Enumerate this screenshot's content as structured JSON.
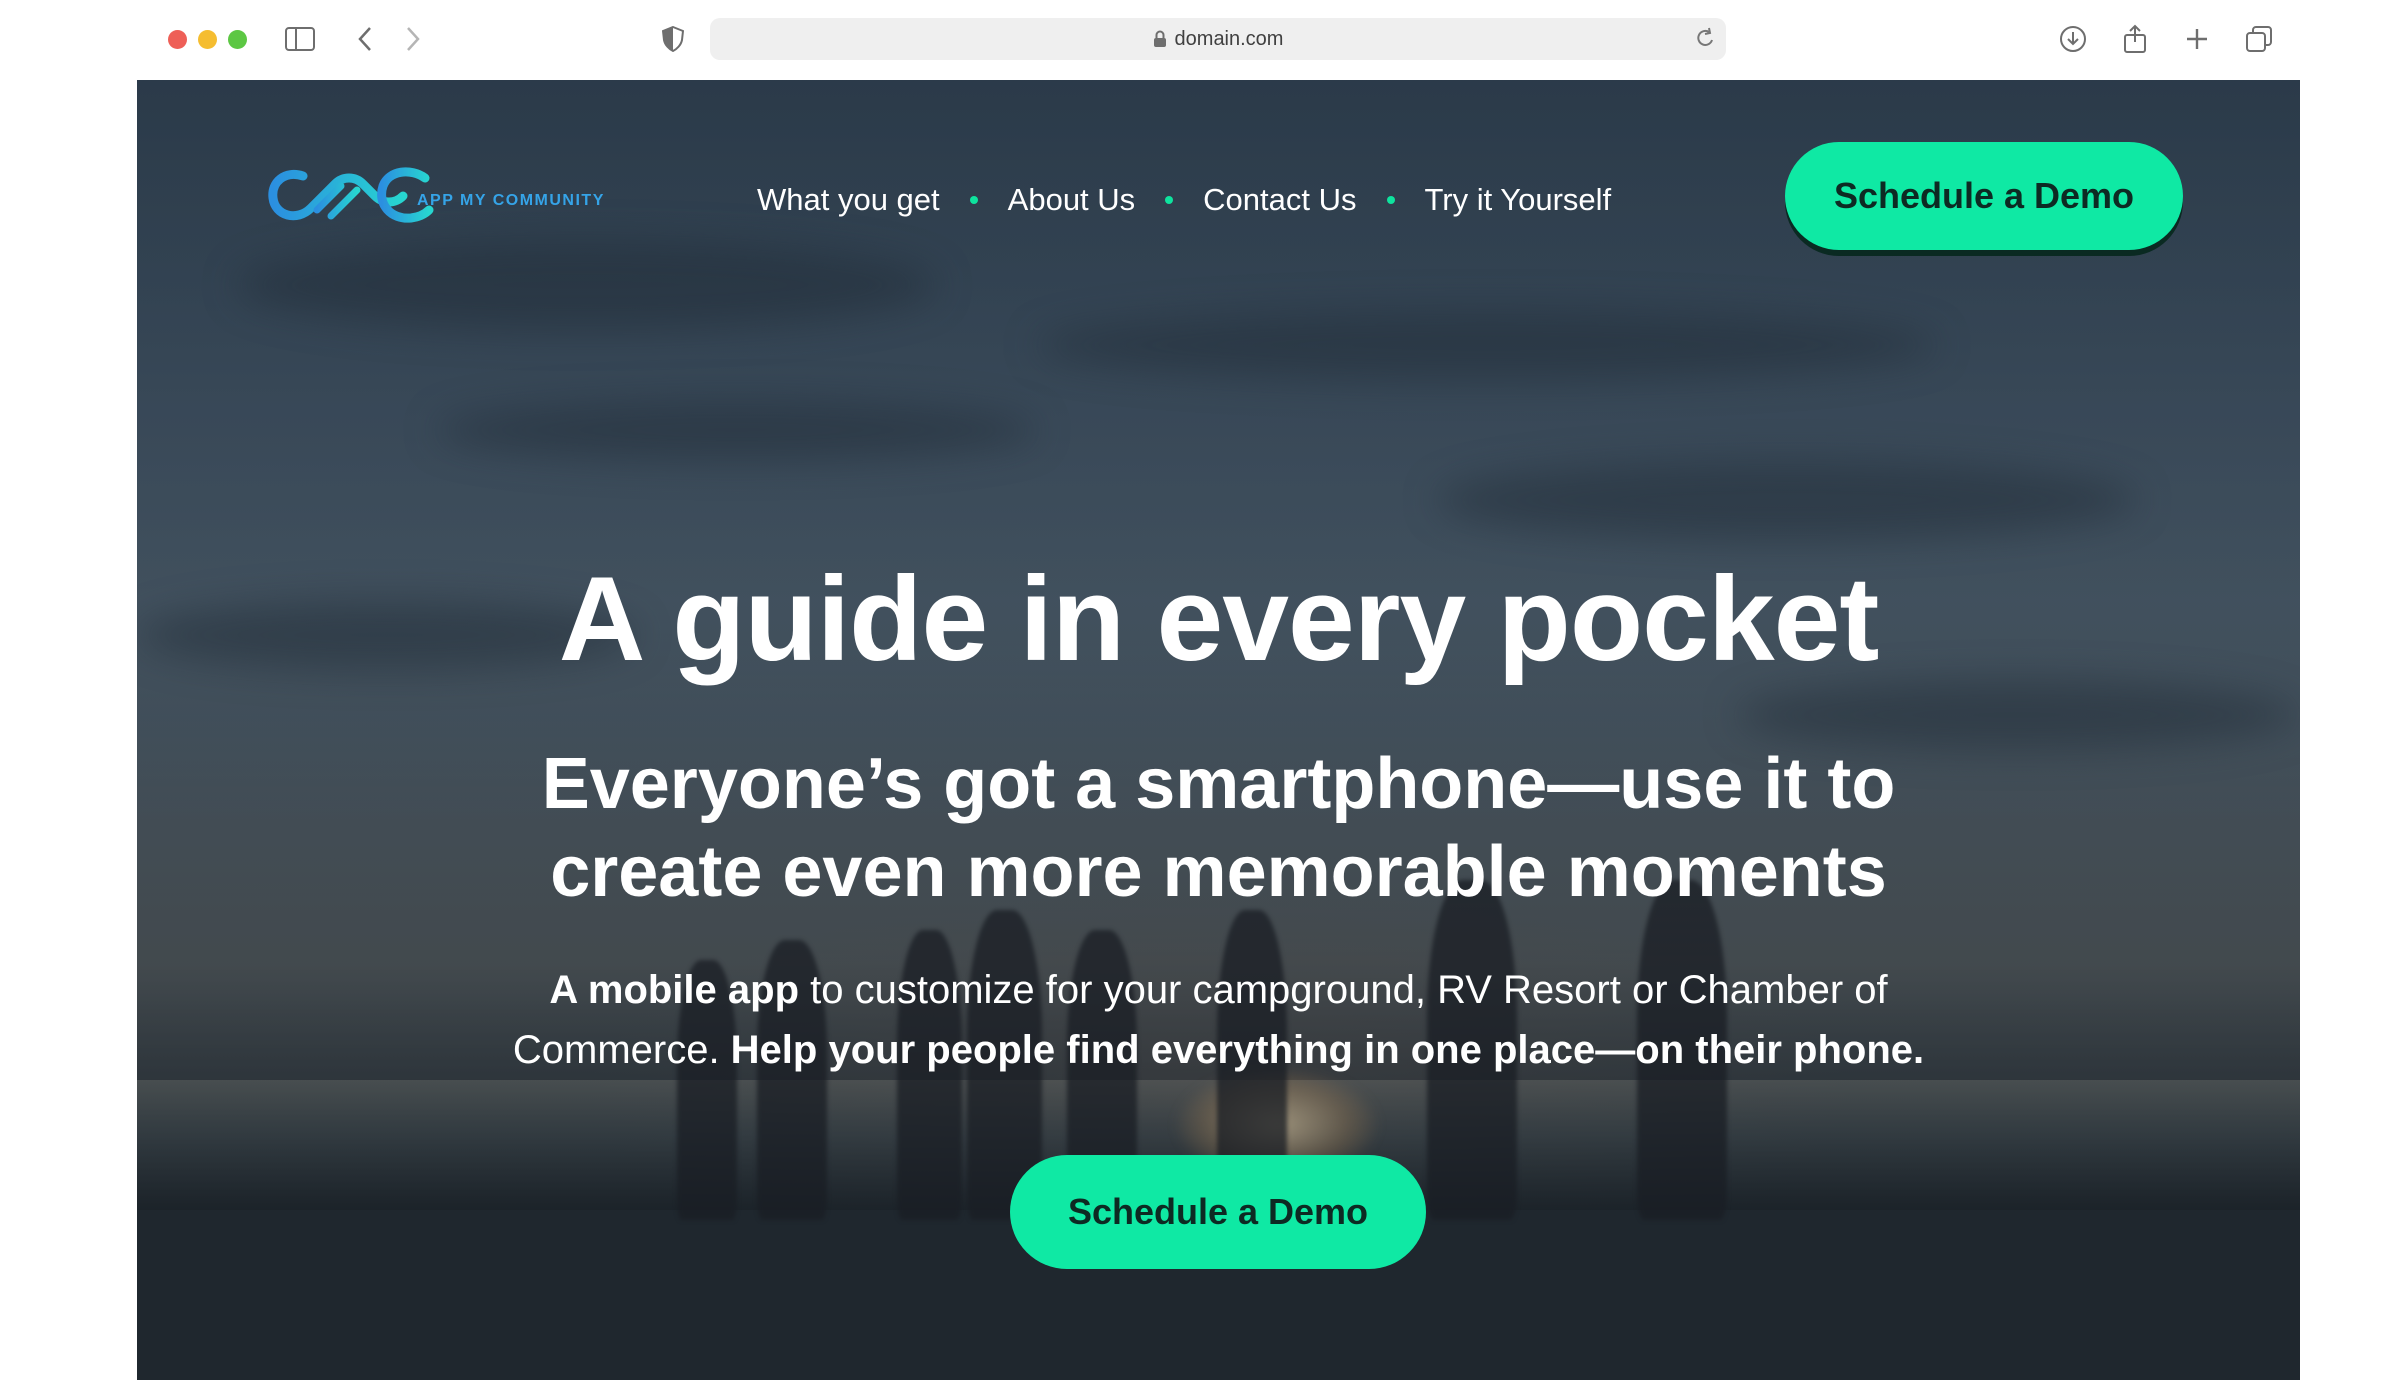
{
  "browser": {
    "url": "domain.com",
    "icons": [
      "sidebar-icon",
      "back-icon",
      "forward-icon",
      "privacy-shield-icon",
      "lock-icon",
      "reload-icon",
      "download-icon",
      "share-icon",
      "new-tab-icon",
      "tabs-overview-icon"
    ]
  },
  "header": {
    "logo_text": "APP MY COMMUNITY",
    "nav": [
      "What you get",
      "About Us",
      "Contact Us",
      "Try it Yourself"
    ],
    "cta_label": "Schedule a Demo"
  },
  "hero": {
    "title": "A guide in every pocket",
    "subtitle": "Everyone’s got a smartphone—use it to create even more memorable moments",
    "desc_part1_bold": "A mobile app",
    "desc_part2": " to customize for your campground, RV Resort or Chamber of Commerce. ",
    "desc_part3_bold": "Help your people find everything in one place—on their phone.",
    "cta_label": "Schedule a Demo"
  },
  "colors": {
    "accent": "#0fe9a4",
    "logo_blue": "#35a4e8",
    "cta_text": "#0d2a23"
  }
}
